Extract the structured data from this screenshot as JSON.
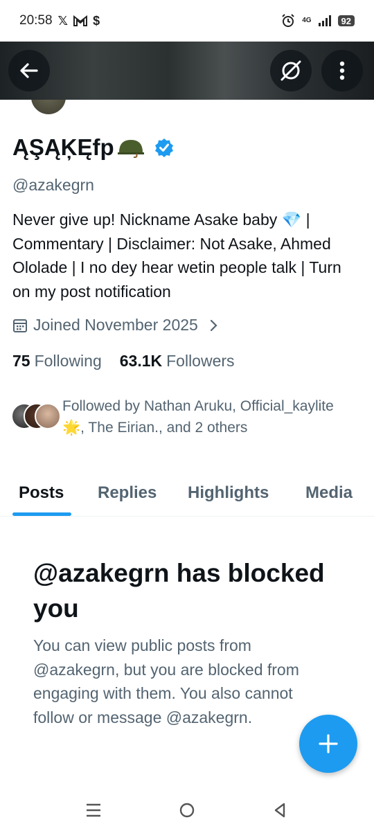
{
  "status_bar": {
    "time": "20:58",
    "notification_icons": [
      "x-logo-icon",
      "gmail-icon",
      "s-app-icon"
    ],
    "network": "4G",
    "battery": "92"
  },
  "profile": {
    "display_name": "ĄŞĄĶĘfp",
    "handle": "@azakegrn",
    "bio": "Never give up! Nickname Asake baby 💎 | Commentary | Disclaimer: Not Asake, Ahmed Ololade | I no dey hear wetin people talk | Turn on my post notification",
    "joined": "Joined November 2025",
    "following_count": "75",
    "following_label": "Following",
    "followers_count": "63.1K",
    "followers_label": "Followers",
    "followed_by": "Followed by Nathan Aruku, Official_kaylite🌟, The Eirian., and 2 others"
  },
  "tabs": [
    {
      "label": "Posts",
      "active": true
    },
    {
      "label": "Replies",
      "active": false
    },
    {
      "label": "Highlights",
      "active": false
    },
    {
      "label": "Media",
      "active": false
    }
  ],
  "blocked": {
    "title": "@azakegrn has blocked you",
    "body": "You can view public posts from @azakegrn, but you are blocked from engaging with them. You also cannot follow or message @azakegrn."
  },
  "colors": {
    "accent": "#1d9bf0",
    "text_primary": "#0f1419",
    "text_secondary": "#536471"
  }
}
